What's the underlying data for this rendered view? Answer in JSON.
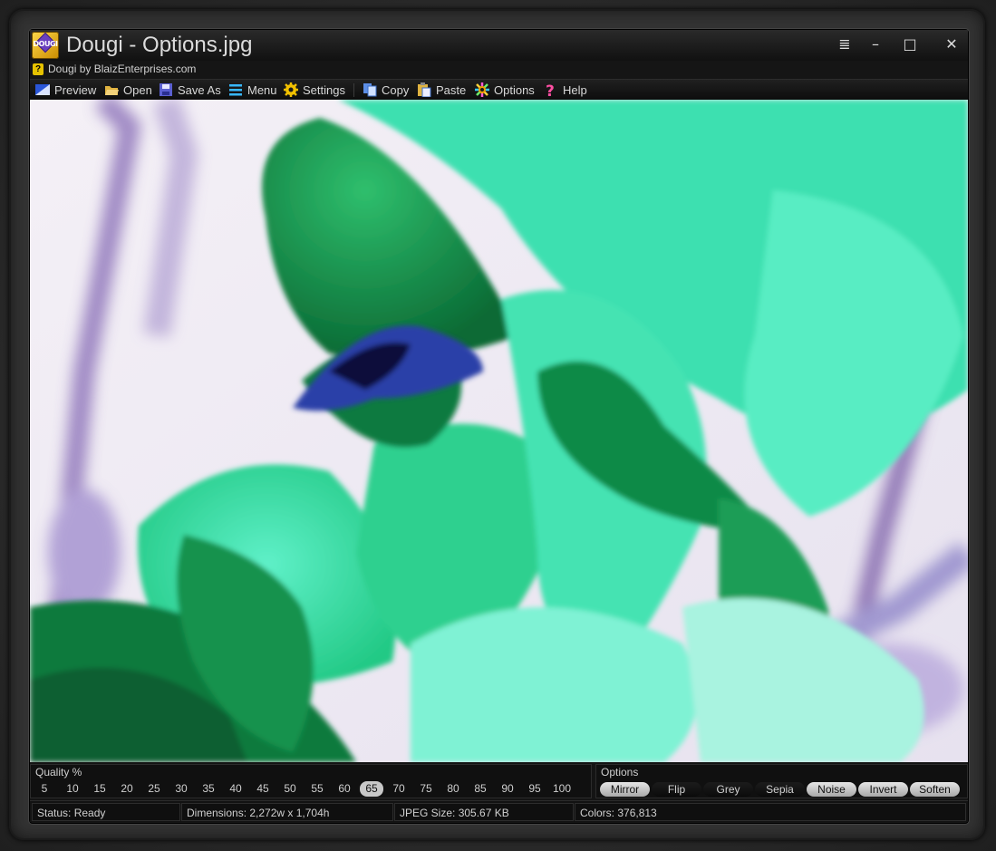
{
  "window": {
    "title": "Dougi - Options.jpg",
    "logo_text": "DOUGI",
    "subtitle": "Dougi by BlaizEnterprises.com",
    "controls": {
      "menu": "≣",
      "minimize": "–",
      "maximize": "□",
      "close": "✕"
    }
  },
  "toolbar": {
    "items": [
      {
        "label": "Preview",
        "icon": "preview-icon"
      },
      {
        "label": "Open",
        "icon": "folder-open-icon"
      },
      {
        "label": "Save As",
        "icon": "floppy-icon"
      },
      {
        "label": "Menu",
        "icon": "hamburger-icon"
      },
      {
        "label": "Settings",
        "icon": "gear-icon"
      },
      {
        "label": "Copy",
        "icon": "copy-icon"
      },
      {
        "label": "Paste",
        "icon": "paste-icon"
      },
      {
        "label": "Options",
        "icon": "gear-color-icon"
      },
      {
        "label": "Help",
        "icon": "question-icon"
      }
    ]
  },
  "image": {
    "description_icon": "inverted-flower-photo"
  },
  "quality": {
    "label": "Quality %",
    "values": [
      "5",
      "10",
      "15",
      "20",
      "25",
      "30",
      "35",
      "40",
      "45",
      "50",
      "55",
      "60",
      "65",
      "70",
      "75",
      "80",
      "85",
      "90",
      "95",
      "100"
    ],
    "selected": "65"
  },
  "options": {
    "label": "Options",
    "buttons": [
      {
        "label": "Mirror",
        "active": true
      },
      {
        "label": "Flip",
        "active": false
      },
      {
        "label": "Grey",
        "active": false
      },
      {
        "label": "Sepia",
        "active": false
      },
      {
        "label": "Noise",
        "active": true
      },
      {
        "label": "Invert",
        "active": true
      },
      {
        "label": "Soften",
        "active": true
      }
    ]
  },
  "status": {
    "status": "Status: Ready",
    "dimensions": "Dimensions: 2,272w x 1,704h",
    "jpeg_size": "JPEG Size: 305.67 KB",
    "colors": "Colors: 376,813"
  },
  "colors": {
    "accent": "#c8c8c8",
    "image_green": "#2fd08f",
    "image_dark_green": "#0f7a3f",
    "image_purple": "#6d4f9e"
  }
}
